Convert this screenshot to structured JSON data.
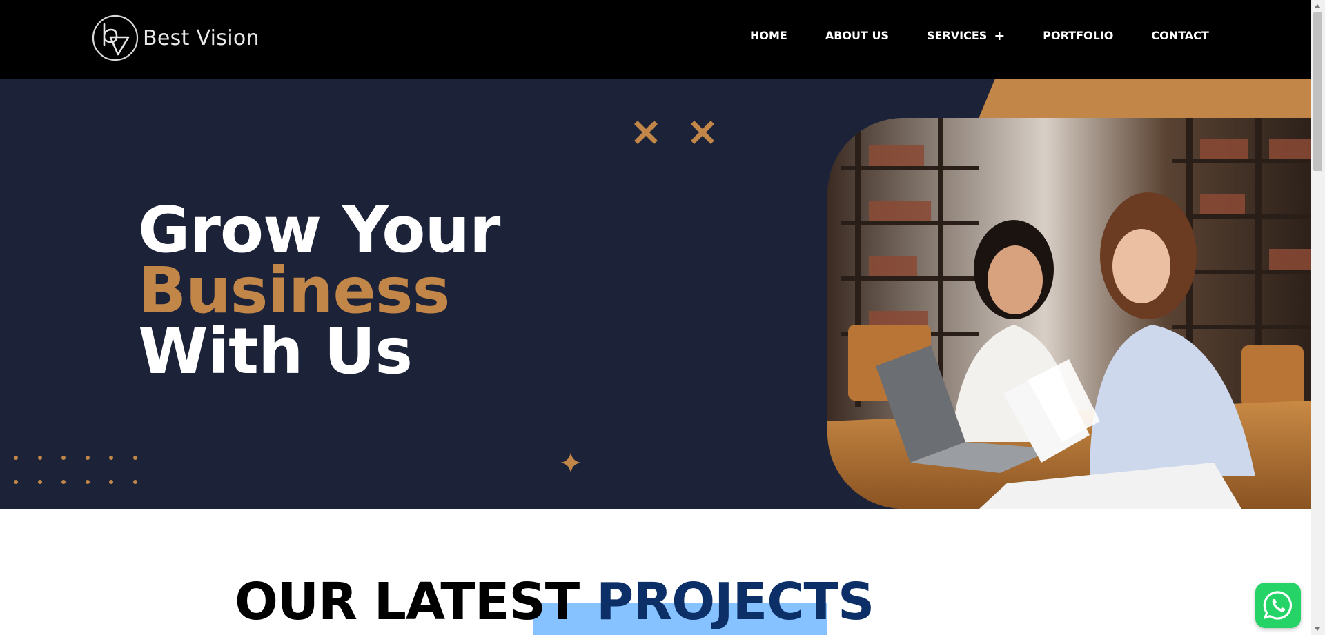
{
  "brand": {
    "name": "Best Vision",
    "logo_icon": "bv-monogram-logo"
  },
  "nav": {
    "items": [
      {
        "label": "HOME"
      },
      {
        "label": "ABOUT US"
      },
      {
        "label": "SERVICES"
      },
      {
        "label": "PORTFOLIO"
      },
      {
        "label": "CONTACT"
      }
    ],
    "services_toggle": "+"
  },
  "hero": {
    "line1": "Grow Your",
    "line2": "Business",
    "line3": "With Us",
    "photo_icon": "two-women-reviewing-documents-photo"
  },
  "section": {
    "title_part1": "OUR LATEST ",
    "title_part2": "PROJECTS"
  },
  "colors": {
    "header_bg": "#000000",
    "hero_bg": "#1c2339",
    "accent": "#c28748",
    "whatsapp": "#25d366",
    "selection": "#86c2ff"
  },
  "floating": {
    "whatsapp_icon": "whatsapp-icon"
  }
}
